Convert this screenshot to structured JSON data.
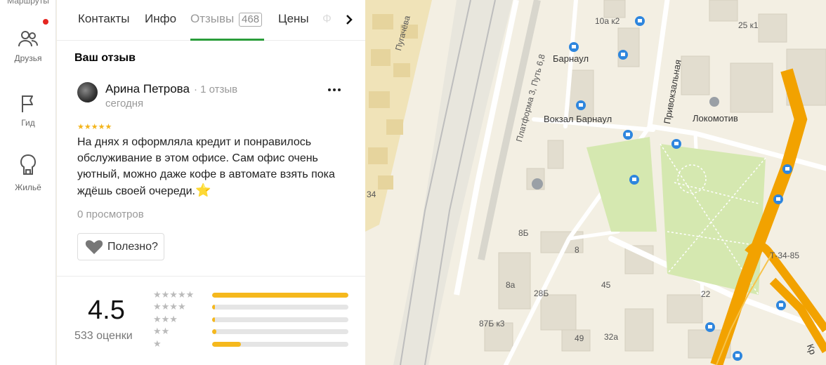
{
  "rail": {
    "top_label": "Маршруты",
    "items": [
      {
        "label": "Друзья",
        "icon": "friends-icon"
      },
      {
        "label": "Гид",
        "icon": "flag-icon"
      },
      {
        "label": "Жильё",
        "icon": "housing-icon"
      }
    ]
  },
  "tabs": {
    "contacts": "Контакты",
    "info": "Инфо",
    "reviews": "Отзывы",
    "reviews_count": "468",
    "prices": "Цены",
    "faded": "Ф"
  },
  "review": {
    "section_title": "Ваш отзыв",
    "author": "Арина Петрова",
    "author_meta": "· 1 отзыв",
    "date": "сегодня",
    "rating_stars": "★★★★★",
    "text": "На днях я оформляла кредит и понравилось обслуживание в этом офисе. Сам офис очень уютный, можно даже кофе в автомате взять пока ждёшь своей очереди.",
    "emoji": "⭐",
    "views": "0 просмотров",
    "helpful_label": "Полезно?"
  },
  "summary": {
    "score": "4.5",
    "count_label": "533 оценки",
    "distribution": [
      {
        "stars": "★★★★★",
        "fraction": 1.0
      },
      {
        "stars": "★★★★",
        "fraction": 0.02
      },
      {
        "stars": "★★★",
        "fraction": 0.01
      },
      {
        "stars": "★★",
        "fraction": 0.03
      },
      {
        "stars": "★",
        "fraction": 0.21
      }
    ]
  },
  "map": {
    "labels": {
      "pugacheva": "Пугачёва",
      "platform": "Платформа 3, Путь 6,8",
      "barnaul": "Барнаул",
      "vokzal": "Вокзал Барнаул",
      "privokzalnaya": "Привокзальная",
      "lokomotiv": "Локомотив",
      "house_10a": "10а к2",
      "house_25k1": "25 к1",
      "house_34": "34",
      "house_8b": "8Б",
      "house_8": "8",
      "house_8a": "8а",
      "house_28b": "28Б",
      "house_87b": "87Б к3",
      "house_45": "45",
      "house_22": "22",
      "house_49": "49",
      "house_32a": "32а",
      "road_t3485": "Т-34-85",
      "road_kr": "Кр"
    },
    "colors": {
      "land": "#f3efe3",
      "park": "#d5e8b0",
      "building": "#e4dfd2",
      "road_major": "#f2a200",
      "road_white": "#ffffff",
      "rail": "#cccccc",
      "metro_blue": "#2e86de"
    }
  }
}
